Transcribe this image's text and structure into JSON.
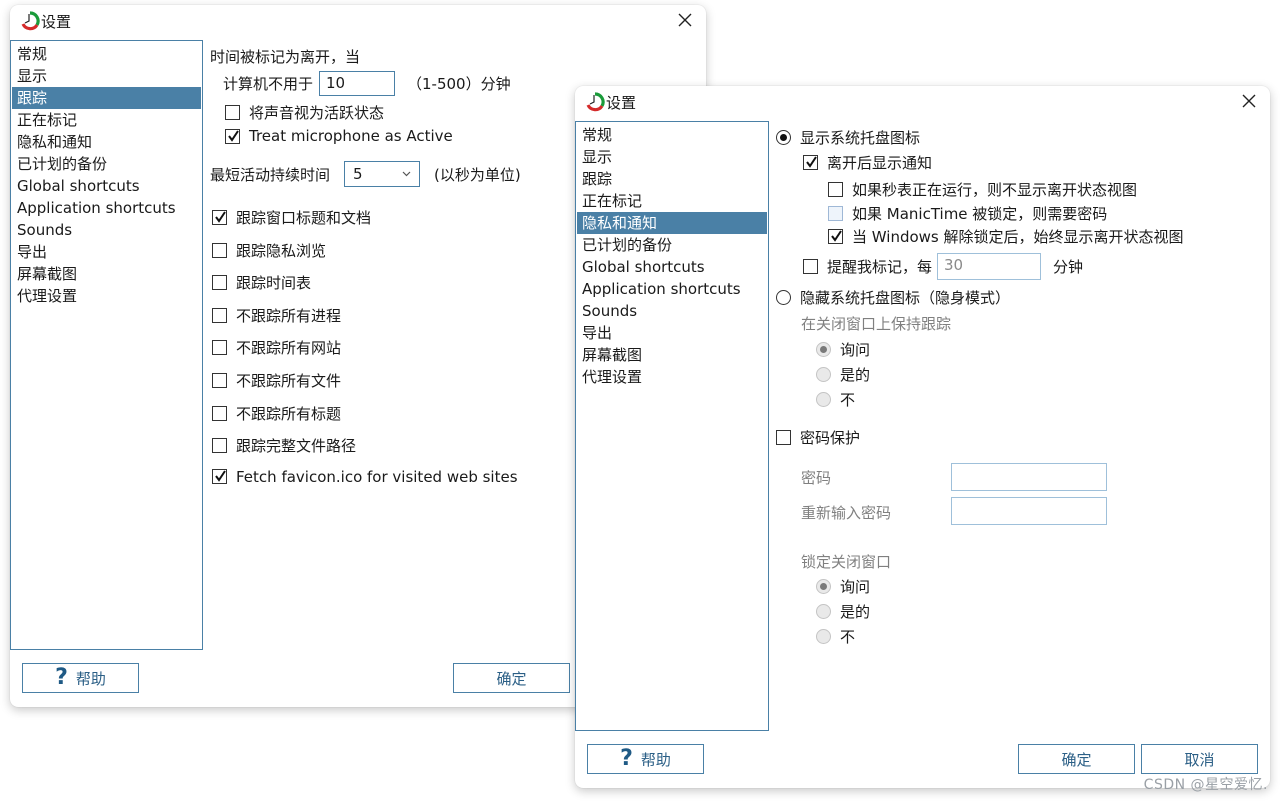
{
  "window1": {
    "title": "设置",
    "nav": [
      "常规",
      "显示",
      "跟踪",
      "正在标记",
      "隐私和通知",
      "已计划的备份",
      "Global shortcuts",
      "Application shortcuts",
      "Sounds",
      "导出",
      "屏幕截图",
      "代理设置"
    ],
    "selected_nav": "跟踪",
    "away_header": "时间被标记为离开，当",
    "idle_label": "计算机不用于",
    "idle_value": "10",
    "idle_range": "（1-500）分钟",
    "sound_active": {
      "label": "将声音视为活跃状态",
      "checked": false
    },
    "mic_active": {
      "label": "Treat microphone as Active",
      "checked": true
    },
    "min_duration_label": "最短活动持续时间",
    "min_duration_value": "5",
    "min_duration_unit": "(以秒为单位)",
    "options": [
      {
        "label": "跟踪窗口标题和文档",
        "checked": true
      },
      {
        "label": "跟踪隐私浏览",
        "checked": false
      },
      {
        "label": "跟踪时间表",
        "checked": false
      },
      {
        "label": "不跟踪所有进程",
        "checked": false
      },
      {
        "label": "不跟踪所有网站",
        "checked": false
      },
      {
        "label": "不跟踪所有文件",
        "checked": false
      },
      {
        "label": "不跟踪所有标题",
        "checked": false
      },
      {
        "label": "跟踪完整文件路径",
        "checked": false
      },
      {
        "label": "Fetch favicon.ico for visited web sites",
        "checked": true
      }
    ],
    "help_label": "帮助",
    "ok_label": "确定"
  },
  "window2": {
    "title": "设置",
    "nav": [
      "常规",
      "显示",
      "跟踪",
      "正在标记",
      "隐私和通知",
      "已计划的备份",
      "Global shortcuts",
      "Application shortcuts",
      "Sounds",
      "导出",
      "屏幕截图",
      "代理设置"
    ],
    "selected_nav": "隐私和通知",
    "show_tray": {
      "label": "显示系统托盘图标",
      "selected": true
    },
    "notify_away": {
      "label": "离开后显示通知",
      "checked": true
    },
    "no_away_stopwatch": {
      "label": "如果秒表正在运行，则不显示离开状态视图",
      "checked": false
    },
    "require_password": {
      "label": "如果 ManicTime 被锁定，则需要密码",
      "checked": false
    },
    "always_show_unlock": {
      "label": "当 Windows 解除锁定后，始终显示离开状态视图",
      "checked": true
    },
    "remind_tag": {
      "label": "提醒我标记，每",
      "checked": false,
      "value": "30",
      "unit": "分钟"
    },
    "hide_tray": {
      "label": "隐藏系统托盘图标（隐身模式）",
      "selected": false
    },
    "keep_tracking_label": "在关闭窗口上保持跟踪",
    "keep_tracking_options": [
      "询问",
      "是的",
      "不"
    ],
    "keep_tracking_selected": "询问",
    "password_protect": {
      "label": "密码保护",
      "checked": false
    },
    "password_label": "密码",
    "password_value": "",
    "reenter_label": "重新输入密码",
    "reenter_value": "",
    "lock_close_label": "锁定关闭窗口",
    "lock_close_options": [
      "询问",
      "是的",
      "不"
    ],
    "lock_close_selected": "询问",
    "help_label": "帮助",
    "ok_label": "确定",
    "cancel_label": "取消"
  },
  "watermark": "CSDN @星空爱忆."
}
